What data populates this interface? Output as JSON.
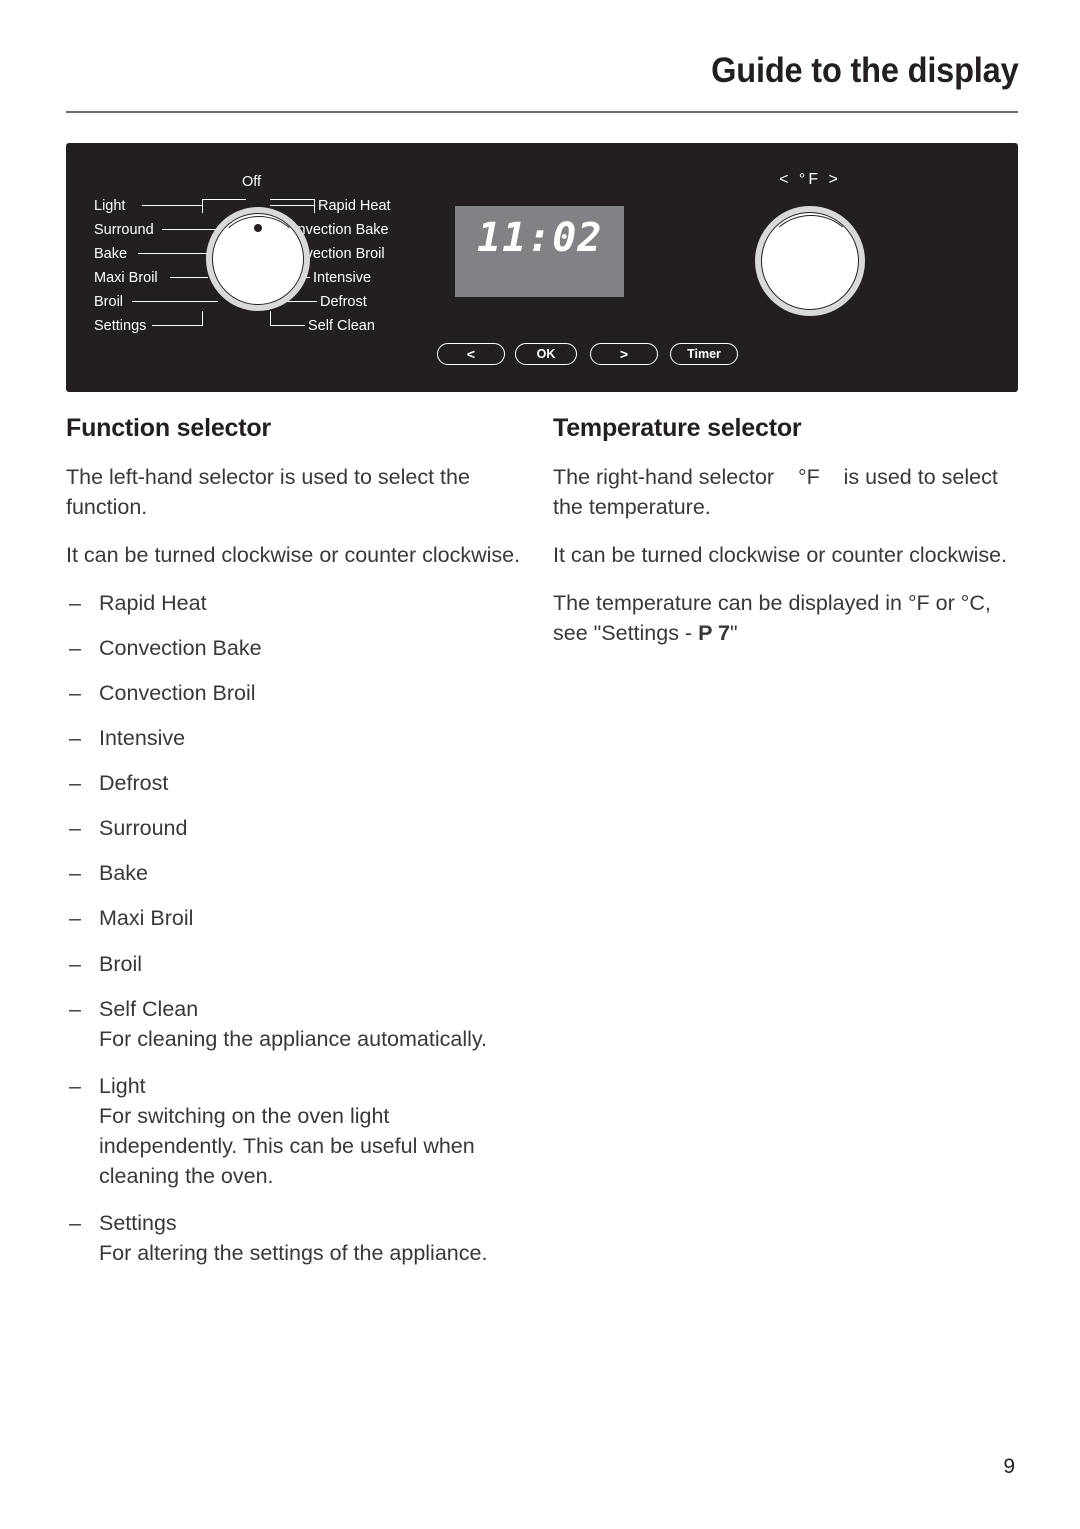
{
  "header": {
    "title": "Guide to the display"
  },
  "control_panel": {
    "off_label": "Off",
    "left_labels": [
      "Light",
      "Surround",
      "Bake",
      "Maxi Broil",
      "Broil",
      "Settings"
    ],
    "right_labels": [
      "Rapid Heat",
      "Convection Bake",
      "Convection Broil",
      "Intensive",
      "Defrost",
      "Self Clean"
    ],
    "display_time": "11:02",
    "temperature_mode": "< °F >",
    "buttons": [
      {
        "name": "previous",
        "label": "<"
      },
      {
        "name": "ok",
        "label": "OK"
      },
      {
        "name": "next",
        "label": ">"
      },
      {
        "name": "timer",
        "label": "Timer"
      }
    ],
    "colors": {
      "panel_background": "#231f20",
      "display_background": "#808285",
      "knob_face": "#ffffff",
      "knob_ring": "#d9d9d9",
      "label_text": "#ffffff"
    }
  },
  "function_selector": {
    "title": "Function selector",
    "paragraph_1": "The left-hand selector is used to select the function.",
    "paragraph_2": "It can be turned clockwise or counter clockwise.",
    "items": [
      {
        "label": "Rapid Heat",
        "description": ""
      },
      {
        "label": "Convection Bake",
        "description": ""
      },
      {
        "label": "Convection Broil",
        "description": ""
      },
      {
        "label": "Intensive",
        "description": ""
      },
      {
        "label": "Defrost",
        "description": ""
      },
      {
        "label": "Surround",
        "description": ""
      },
      {
        "label": "Bake",
        "description": ""
      },
      {
        "label": "Maxi Broil",
        "description": ""
      },
      {
        "label": "Broil",
        "description": ""
      },
      {
        "label": "Self Clean",
        "description": "For cleaning the appliance automatically."
      },
      {
        "label": "Light",
        "description": "For switching on the oven light independently. This can be useful when cleaning the oven."
      },
      {
        "label": "Settings",
        "description": "For altering the settings of the appliance."
      }
    ],
    "dash": "–"
  },
  "temperature_selector": {
    "title": "Temperature selector",
    "paragraph_1_a": "The right-hand selector",
    "paragraph_1_symbol": "°F",
    "paragraph_1_b": "is used to select the temperature.",
    "paragraph_2": "It can be turned clockwise or counter clockwise.",
    "paragraph_3_a": "The temperature can be displayed in °F or °C, see \"Settings -",
    "paragraph_3_bold": "P 7",
    "paragraph_3_b": "\""
  },
  "footer": {
    "page_number": "9"
  }
}
